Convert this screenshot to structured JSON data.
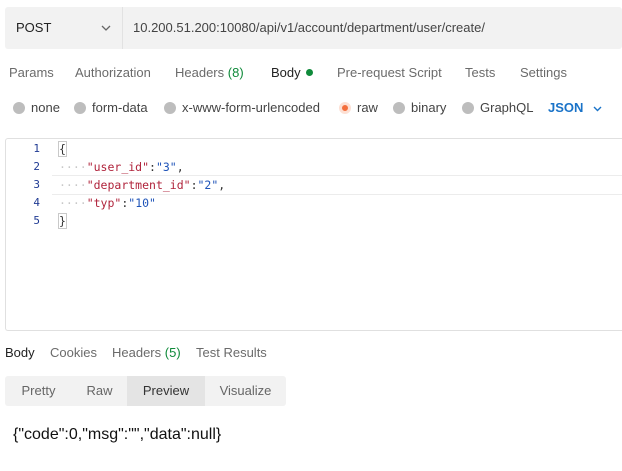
{
  "request": {
    "method": "POST",
    "url": "10.200.51.200:10080/api/v1/account/department/user/create/"
  },
  "request_tabs": {
    "params": "Params",
    "authorization": "Authorization",
    "headers": "Headers",
    "headers_count": "(8)",
    "body": "Body",
    "prerequest": "Pre-request Script",
    "tests": "Tests",
    "settings": "Settings"
  },
  "body_types": {
    "none": "none",
    "form_data": "form-data",
    "urlencoded": "x-www-form-urlencoded",
    "raw": "raw",
    "binary": "binary",
    "graphql": "GraphQL",
    "selected_format": "JSON"
  },
  "editor": {
    "line_numbers": [
      "1",
      "2",
      "3",
      "4",
      "5"
    ],
    "lines": {
      "open": "{",
      "k1": "\"user_id\"",
      "v1": "\"3\"",
      "k2": "\"department_id\"",
      "v2": "\"2\"",
      "k3": "\"typ\"",
      "v3": "\"10\"",
      "close": "}"
    }
  },
  "response_tabs": {
    "body": "Body",
    "cookies": "Cookies",
    "headers": "Headers",
    "headers_count": "(5)",
    "test_results": "Test Results"
  },
  "view_modes": {
    "pretty": "Pretty",
    "raw": "Raw",
    "preview": "Preview",
    "visualize": "Visualize"
  },
  "response_body": "{\"code\":0,\"msg\":\"\",\"data\":null}",
  "colors": {
    "accent_green": "#0f8a3a",
    "raw_radio": "#f36e3c",
    "json_blue": "#1a73c8",
    "key_red": "#b0233b",
    "string_blue": "#1e53b8"
  }
}
